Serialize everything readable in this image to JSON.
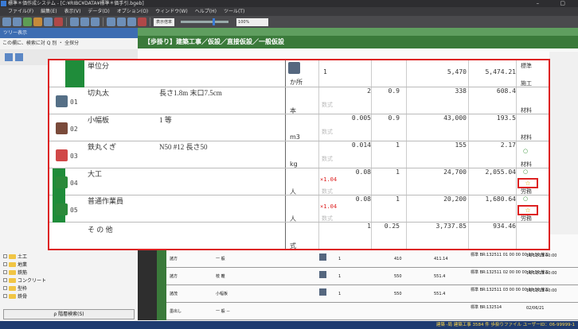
{
  "window": {
    "title": "標準＊価作成システム - [C:¥RIBC¥DATA¥標準＊価手引.bgeb]",
    "controls": "– ▢"
  },
  "menu": [
    "ファイル(F)",
    "編集(E)",
    "表示(V)",
    "データ(D)",
    "オプション(O)",
    "ウィンドウ(W)",
    "ヘルプ(H)",
    "ツール(T)"
  ],
  "toolbar": {
    "field_label": "表示倍率",
    "zoom": "100%"
  },
  "tree": {
    "header": "ツリー表示",
    "search_label": "この欄に、検索に対 Q 別 ・ 全探分",
    "items": [
      "土工",
      "地業",
      "鉄筋",
      "コンクリート",
      "型枠",
      "鉄骨"
    ],
    "search_button": "ρ 階層検索(S)"
  },
  "main": {
    "header": "【歩掛り】建築工事／仮設／直接仮設／一般仮設"
  },
  "overlay": {
    "title": "単位分",
    "title_unit": "か所",
    "title_qty": "1",
    "title_price": "5,470",
    "title_amount": "5,474.21",
    "title_type": "標準",
    "title_type2": "施工",
    "rows": [
      {
        "num": "01",
        "name": "切丸太",
        "spec": "長さ1.8m 末口7.5cm",
        "unit": "本",
        "formula": "数式",
        "qty": "2",
        "mult": "",
        "coef": "0.9",
        "price": "338",
        "amount": "608.4",
        "type": "材料",
        "circle": "",
        "star": "",
        "icon_color": "#556f86"
      },
      {
        "num": "02",
        "name": "小幅板",
        "spec": "1 等",
        "unit": "m3",
        "formula": "数式",
        "qty": "0.005",
        "mult": "",
        "coef": "0.9",
        "price": "43,000",
        "amount": "193.5",
        "type": "材料",
        "circle": "",
        "star": "",
        "icon_color": "#7a4a3a"
      },
      {
        "num": "03",
        "name": "鉄丸くぎ",
        "spec": "N50 #12 長さ50",
        "unit": "kg",
        "formula": "数式",
        "qty": "0.014",
        "mult": "",
        "coef": "1",
        "price": "155",
        "amount": "2.17",
        "type": "材料",
        "circle": "○",
        "star": "",
        "icon_color": "#d04848"
      },
      {
        "num": "04",
        "name": "大工",
        "spec": "",
        "unit": "人",
        "formula": "数式",
        "qty": "0.08",
        "mult": "×1.04",
        "coef": "1",
        "price": "24,700",
        "amount": "2,055.04",
        "type": "労務",
        "circle": "○",
        "star": "☆",
        "icon_color": "#2a8a3a"
      },
      {
        "num": "05",
        "name": "普通作業員",
        "spec": "",
        "unit": "人",
        "formula": "数式",
        "qty": "0.08",
        "mult": "×1.04",
        "coef": "1",
        "price": "20,200",
        "amount": "1,680.64",
        "type": "労務",
        "circle": "○",
        "star": "☆",
        "icon_color": "#2a8a3a"
      },
      {
        "num": "",
        "name": "そ の 他",
        "spec": "",
        "unit": "式",
        "formula": "",
        "qty": "1",
        "mult": "",
        "coef": "0.25",
        "price": "3,737.85",
        "amount": "934.46",
        "type": "",
        "circle": "",
        "star": "",
        "icon_color": ""
      }
    ]
  },
  "background_rows": [
    {
      "col1": "諸方",
      "col2": "一 般",
      "qty": "1",
      "price": "410",
      "amount": "411.14",
      "kw": "標準 BR:132511\n01 00 00 00 00 00 施工",
      "date": "16/12/23\n00:00"
    },
    {
      "col1": "諸方",
      "col2": "枝 離",
      "qty": "1",
      "price": "550",
      "amount": "551.4",
      "kw": "標準 BR:132511\n02 00 00 00 00 00 施工",
      "date": "16/12/23\n00:00"
    },
    {
      "col1": "諸茂",
      "col2": "小幅板",
      "qty": "1",
      "price": "550",
      "amount": "551.4",
      "kw": "標準 BR:132511\n03 00 00 00 00 00 施工",
      "date": "16/12/23\n00:00"
    },
    {
      "col1": "墨出し",
      "col2": "一 般 －",
      "qty": "",
      "price": "",
      "amount": "",
      "kw": "標準 BR:132514",
      "date": "02/06/21"
    }
  ],
  "statusbar": "建築 -局 建築工事 3584 件 歩掛りファイル ユーザーID：06-99999-1"
}
